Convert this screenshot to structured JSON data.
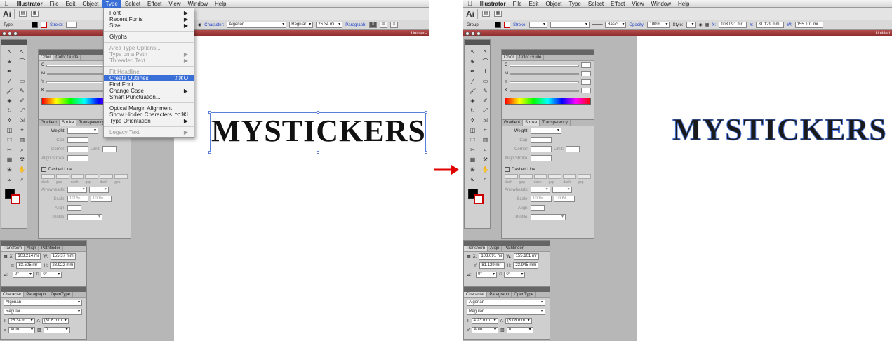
{
  "menubar": {
    "apple": "",
    "app": "Illustrator",
    "items": [
      "File",
      "Edit",
      "Object",
      "Type",
      "Select",
      "Effect",
      "View",
      "Window",
      "Help"
    ],
    "active_index": 3
  },
  "appbar": {
    "logo": "Ai"
  },
  "left": {
    "control": {
      "selection_label": "Type",
      "stroke_label": "Stroke:",
      "character_label": "Character:",
      "font": "Algerian",
      "style": "Regular",
      "size": "26.34 mi",
      "paragraph_label": "Paragraph:"
    },
    "doc_title": "Untitled-",
    "object_text": "MYSTICKERS",
    "type_menu": [
      {
        "label": "Font",
        "shortcut": "▶",
        "enabled": true
      },
      {
        "label": "Recent Fonts",
        "shortcut": "▶",
        "enabled": true
      },
      {
        "label": "Size",
        "shortcut": "▶",
        "enabled": true
      },
      {
        "sep": true
      },
      {
        "label": "Glyphs",
        "shortcut": "",
        "enabled": true
      },
      {
        "sep": true
      },
      {
        "label": "Area Type Options...",
        "shortcut": "",
        "enabled": false
      },
      {
        "label": "Type on a Path",
        "shortcut": "▶",
        "enabled": false
      },
      {
        "label": "Threaded Text",
        "shortcut": "▶",
        "enabled": false
      },
      {
        "sep": true
      },
      {
        "label": "Fit Headline",
        "shortcut": "",
        "enabled": false
      },
      {
        "label": "Create Outlines",
        "shortcut": "⇧⌘O",
        "enabled": true,
        "highlight": true
      },
      {
        "label": "Find Font...",
        "shortcut": "",
        "enabled": true
      },
      {
        "label": "Change Case",
        "shortcut": "▶",
        "enabled": true
      },
      {
        "label": "Smart Punctuation...",
        "shortcut": "",
        "enabled": true
      },
      {
        "sep": true
      },
      {
        "label": "Optical Margin Alignment",
        "shortcut": "",
        "enabled": true
      },
      {
        "label": "Show Hidden Characters",
        "shortcut": "⌥⌘I",
        "enabled": true
      },
      {
        "label": "Type Orientation",
        "shortcut": "▶",
        "enabled": true
      },
      {
        "sep": true
      },
      {
        "label": "Legacy Text",
        "shortcut": "▶",
        "enabled": false
      }
    ],
    "transform": {
      "x": "103.214 mr",
      "y": "83.605 mr",
      "w": "155.37 mm",
      "h": "28.922 mm",
      "angle": "0°",
      "shear": "0°"
    },
    "character": {
      "font": "Algerian",
      "style": "Regular",
      "size": "26.34 m",
      "leading": "(31.6 mm",
      "tracking_v": "Auto",
      "kerning": "0"
    }
  },
  "right": {
    "control": {
      "selection_label": "Group",
      "stroke_label": "Stroke:",
      "brush": "Basic",
      "opacity_label": "Opacity:",
      "opacity": "100%",
      "style_label": "Style:",
      "x": "103.091 mr",
      "y": "81.129 mm",
      "w": "155.101 mr"
    },
    "doc_title": "Untitled",
    "object_text": "MYSTICKERS",
    "transform": {
      "x": "103.091 mr",
      "y": "81.129 mr",
      "w": "155.101 mr",
      "h": "23.945 mm",
      "angle": "0°",
      "shear": "0°"
    },
    "character": {
      "font": "Algerian",
      "style": "Regular",
      "size": "4.23 mm",
      "leading": "(5.08 mm",
      "tracking_v": "Auto",
      "kerning": "0"
    }
  },
  "panels": {
    "color_tabs": [
      "Color",
      "Color Guide"
    ],
    "color_rows": [
      "C",
      "M",
      "Y",
      "K"
    ],
    "stroke_tabs": [
      "Gradient",
      "Stroke",
      "Transparency"
    ],
    "weight_label": "Weight:",
    "cap_label": "Cap:",
    "corner_label": "Corner:",
    "limit_label": "Limit:",
    "align_stroke_label": "Align Stroke:",
    "dashed_line": "Dashed Line",
    "dash_labels": [
      "dash",
      "gap",
      "dash",
      "gap",
      "dash",
      "gap"
    ],
    "arrowheads_label": "Arrowheads:",
    "scale_label": "Scale:",
    "scale_a": "100%",
    "scale_b": "100%",
    "align_label": "Align:",
    "profile_label": "Profile:",
    "transform_tabs": [
      "Transform",
      "Align",
      "Pathfinder"
    ],
    "character_tabs": [
      "Character",
      "Paragraph",
      "OpenType"
    ],
    "x_label": "X:",
    "y_label": "Y:",
    "w_label": "W:",
    "h_label": "H:",
    "angle_label": "⊿:",
    "shear_label": "⫽:"
  },
  "colors": {
    "menu_highlight": "#3b6fd8",
    "arrow": "#e00000",
    "selection": "#5a7fd8"
  },
  "tools": [
    "↖",
    "↖",
    "⊕",
    "⌒",
    "✒",
    "T",
    "╱",
    "▭",
    "🖌",
    "✎",
    "◈",
    "✐",
    "↻",
    "⤢",
    "✲",
    "⇲",
    "◫",
    "⌗",
    "⬚",
    "▥",
    "✂",
    "⌕",
    "▦",
    "⚒",
    "⊞",
    "✋",
    "⊙",
    "⌕"
  ]
}
